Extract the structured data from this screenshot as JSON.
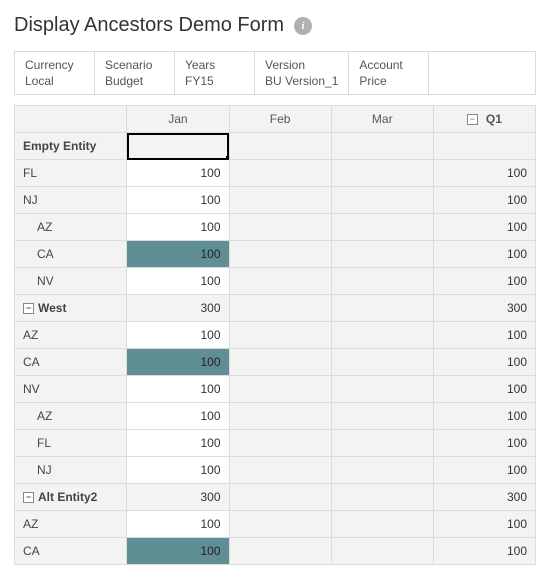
{
  "title": "Display Ancestors Demo Form",
  "pov": [
    {
      "dim": "Currency",
      "val": "Local"
    },
    {
      "dim": "Scenario",
      "val": "Budget"
    },
    {
      "dim": "Years",
      "val": "FY15"
    },
    {
      "dim": "Version",
      "val": "BU Version_1"
    },
    {
      "dim": "Account",
      "val": "Price"
    }
  ],
  "columns": {
    "jan": "Jan",
    "feb": "Feb",
    "mar": "Mar",
    "q1": "Q1",
    "q1_expand_glyph": "−"
  },
  "rows": [
    {
      "label": "Empty Entity",
      "indent": 0,
      "bold": true,
      "expand": null,
      "jan": "",
      "feb": "",
      "mar": "",
      "q1": "",
      "jan_hl": false,
      "jan_sel": true
    },
    {
      "label": "FL",
      "indent": 0,
      "bold": false,
      "expand": null,
      "jan": "100",
      "feb": "",
      "mar": "",
      "q1": "100",
      "jan_hl": false,
      "jan_sel": false
    },
    {
      "label": "NJ",
      "indent": 0,
      "bold": false,
      "expand": null,
      "jan": "100",
      "feb": "",
      "mar": "",
      "q1": "100",
      "jan_hl": false,
      "jan_sel": false
    },
    {
      "label": "AZ",
      "indent": 1,
      "bold": false,
      "expand": null,
      "jan": "100",
      "feb": "",
      "mar": "",
      "q1": "100",
      "jan_hl": false,
      "jan_sel": false
    },
    {
      "label": "CA",
      "indent": 1,
      "bold": false,
      "expand": null,
      "jan": "100",
      "feb": "",
      "mar": "",
      "q1": "100",
      "jan_hl": true,
      "jan_sel": false
    },
    {
      "label": "NV",
      "indent": 1,
      "bold": false,
      "expand": null,
      "jan": "100",
      "feb": "",
      "mar": "",
      "q1": "100",
      "jan_hl": false,
      "jan_sel": false
    },
    {
      "label": "West",
      "indent": 0,
      "bold": true,
      "expand": "−",
      "jan": "300",
      "feb": "",
      "mar": "",
      "q1": "300",
      "jan_hl": false,
      "jan_sel": false
    },
    {
      "label": "AZ",
      "indent": 0,
      "bold": false,
      "expand": null,
      "jan": "100",
      "feb": "",
      "mar": "",
      "q1": "100",
      "jan_hl": false,
      "jan_sel": false
    },
    {
      "label": "CA",
      "indent": 0,
      "bold": false,
      "expand": null,
      "jan": "100",
      "feb": "",
      "mar": "",
      "q1": "100",
      "jan_hl": true,
      "jan_sel": false
    },
    {
      "label": "NV",
      "indent": 0,
      "bold": false,
      "expand": null,
      "jan": "100",
      "feb": "",
      "mar": "",
      "q1": "100",
      "jan_hl": false,
      "jan_sel": false
    },
    {
      "label": "AZ",
      "indent": 1,
      "bold": false,
      "expand": null,
      "jan": "100",
      "feb": "",
      "mar": "",
      "q1": "100",
      "jan_hl": false,
      "jan_sel": false
    },
    {
      "label": "FL",
      "indent": 1,
      "bold": false,
      "expand": null,
      "jan": "100",
      "feb": "",
      "mar": "",
      "q1": "100",
      "jan_hl": false,
      "jan_sel": false
    },
    {
      "label": "NJ",
      "indent": 1,
      "bold": false,
      "expand": null,
      "jan": "100",
      "feb": "",
      "mar": "",
      "q1": "100",
      "jan_hl": false,
      "jan_sel": false
    },
    {
      "label": "Alt Entity2",
      "indent": 0,
      "bold": true,
      "expand": "−",
      "jan": "300",
      "feb": "",
      "mar": "",
      "q1": "300",
      "jan_hl": false,
      "jan_sel": false
    },
    {
      "label": "AZ",
      "indent": 0,
      "bold": false,
      "expand": null,
      "jan": "100",
      "feb": "",
      "mar": "",
      "q1": "100",
      "jan_hl": false,
      "jan_sel": false
    },
    {
      "label": "CA",
      "indent": 0,
      "bold": false,
      "expand": null,
      "jan": "100",
      "feb": "",
      "mar": "",
      "q1": "100",
      "jan_hl": true,
      "jan_sel": false
    }
  ]
}
